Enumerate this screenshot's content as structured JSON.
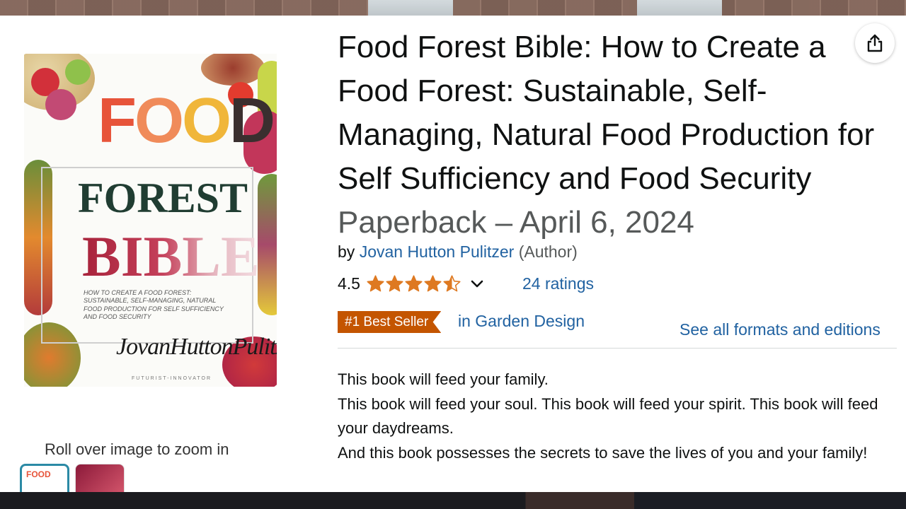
{
  "product": {
    "title_main": "Food Forest Bible: How to Create a Food Forest: Sustainable, Self-Managing, Natural Food Production for Self Sufficiency and Food Security",
    "format_date": "Paperback – April 6, 2024",
    "by_prefix": "by",
    "author": "Jovan Hutton Pulitzer",
    "author_role": "(Author)",
    "rating": "4.5",
    "ratings_count": "24 ratings",
    "stars_value": 4.5,
    "badge": "#1 Best Seller",
    "badge_category": "in Garden Design",
    "formats_link": "See all formats and editions",
    "description": [
      "This book will feed your family.",
      "This book will feed your soul. This book will feed your spirit. This book will feed your daydreams.",
      "And this book possesses the secrets to save the lives of you and your family!"
    ]
  },
  "gallery": {
    "zoom_hint": "Roll over image to zoom in",
    "cover": {
      "word1": [
        "F",
        "O",
        "O",
        "D"
      ],
      "word2": "FOREST",
      "word3": "BIBLE",
      "subtitle": "How to create a food forest: sustainable, self-managing, natural food production for self sufficiency and food security",
      "signature": "JovanHuttonPulitzer",
      "tagline": "FUTURIST-INNOVATOR"
    },
    "thumb1_label": "FOOD"
  },
  "icons": {
    "share": "share-icon",
    "star": "star-icon",
    "chevron": "chevron-down-icon"
  },
  "colors": {
    "link": "#2162a1",
    "badge": "#c45500",
    "star": "#de7921",
    "text": "#0f1111",
    "muted": "#565959"
  }
}
